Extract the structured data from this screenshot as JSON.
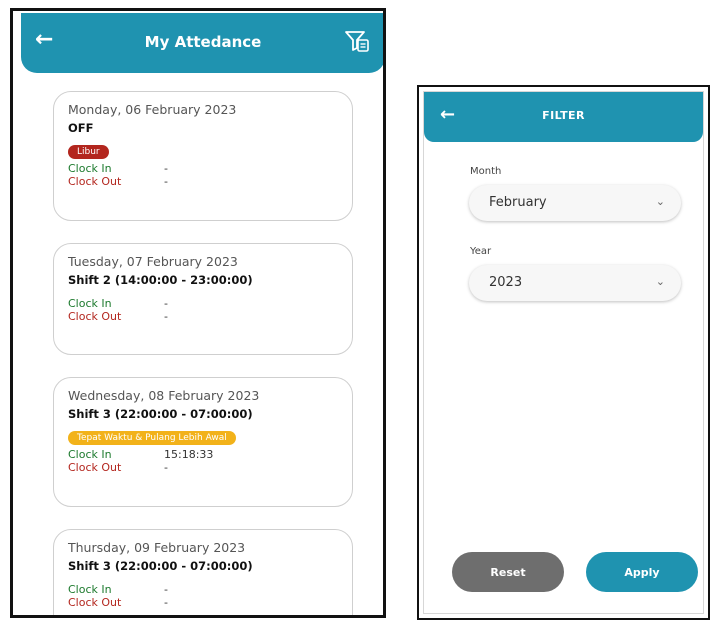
{
  "attendance": {
    "title": "My Attedance",
    "back_icon": "arrow-left-icon",
    "filter_icon": "filter-list-icon",
    "cards": [
      {
        "date": "Monday, 06 February 2023",
        "shift": "OFF",
        "badge": "Libur",
        "badge_color": "#b3261e",
        "clock_in_label": "Clock In",
        "clock_in_value": "-",
        "clock_out_label": "Clock Out",
        "clock_out_value": "-"
      },
      {
        "date": "Tuesday, 07 February 2023",
        "shift": "Shift 2 (14:00:00 - 23:00:00)",
        "clock_in_label": "Clock In",
        "clock_in_value": "-",
        "clock_out_label": "Clock Out",
        "clock_out_value": "-"
      },
      {
        "date": "Wednesday, 08 February 2023",
        "shift": "Shift 3 (22:00:00 - 07:00:00)",
        "badge": "Tepat Waktu & Pulang Lebih Awal",
        "badge_color": "#f2b21a",
        "clock_in_label": "Clock In",
        "clock_in_value": "15:18:33",
        "clock_out_label": "Clock Out",
        "clock_out_value": "-"
      },
      {
        "date": "Thursday, 09 February 2023",
        "shift": "Shift 3 (22:00:00 - 07:00:00)",
        "clock_in_label": "Clock In",
        "clock_in_value": "-",
        "clock_out_label": "Clock Out",
        "clock_out_value": "-"
      }
    ]
  },
  "filter": {
    "title": "FILTER",
    "back_icon": "arrow-left-icon",
    "month_label": "Month",
    "month_value": "February",
    "year_label": "Year",
    "year_value": "2023",
    "chevron_icon": "chevron-down-icon",
    "reset_label": "Reset",
    "apply_label": "Apply"
  },
  "colors": {
    "primary": "#1f93b0",
    "reset_button": "#6e6e6e",
    "clock_in": "#1d7a2e",
    "clock_out": "#b3261e"
  }
}
